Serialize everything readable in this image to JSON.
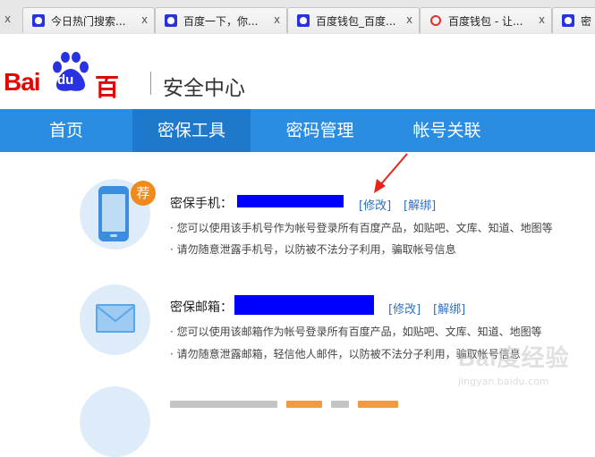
{
  "browser": {
    "tabs": [
      {
        "title": "今日热门搜索...",
        "favicon": "baidu-paw-icon"
      },
      {
        "title": "百度一下，你...",
        "favicon": "baidu-paw-icon"
      },
      {
        "title": "百度钱包_百度...",
        "favicon": "baidu-paw-icon"
      },
      {
        "title": "百度钱包 - 让...",
        "favicon": "wallet-icon"
      },
      {
        "title": "密",
        "favicon": "baidu-paw-icon"
      }
    ],
    "close_glyph": "x"
  },
  "header": {
    "logo_bai": "Bai",
    "logo_du": "du",
    "logo_cn": "百度",
    "title": "安全中心"
  },
  "nav": {
    "items": [
      "首页",
      "密保工具",
      "密码管理",
      "帐号关联"
    ],
    "active_index": 1
  },
  "security": {
    "phone": {
      "badge": "荐",
      "label": "密保手机：",
      "modify": "[修改]",
      "unbind": "[解绑]",
      "bullets": [
        "· 您可以使用该手机号作为帐号登录所有百度产品，如贴吧、文库、知道、地图等",
        "· 请勿随意泄露手机号，以防被不法分子利用，骗取帐号信息"
      ]
    },
    "email": {
      "label": "密保邮箱：",
      "modify": "[修改]",
      "unbind": "[解绑]",
      "bullets": [
        "· 您可以使用该邮箱作为帐号登录所有百度产品，如贴吧、文库、知道、地图等",
        "· 请勿随意泄露邮箱，轻信他人邮件，以防被不法分子利用，骗取帐号信息"
      ]
    }
  },
  "watermark": {
    "text": "Bai度经验",
    "url": "jingyan.baidu.com"
  },
  "colors": {
    "nav": "#2b8de2",
    "nav_active": "#1e78cb",
    "brand_red": "#e10602",
    "redaction": "#0000ff",
    "link": "#2d6fc5",
    "annotation_arrow": "#e8231a"
  }
}
